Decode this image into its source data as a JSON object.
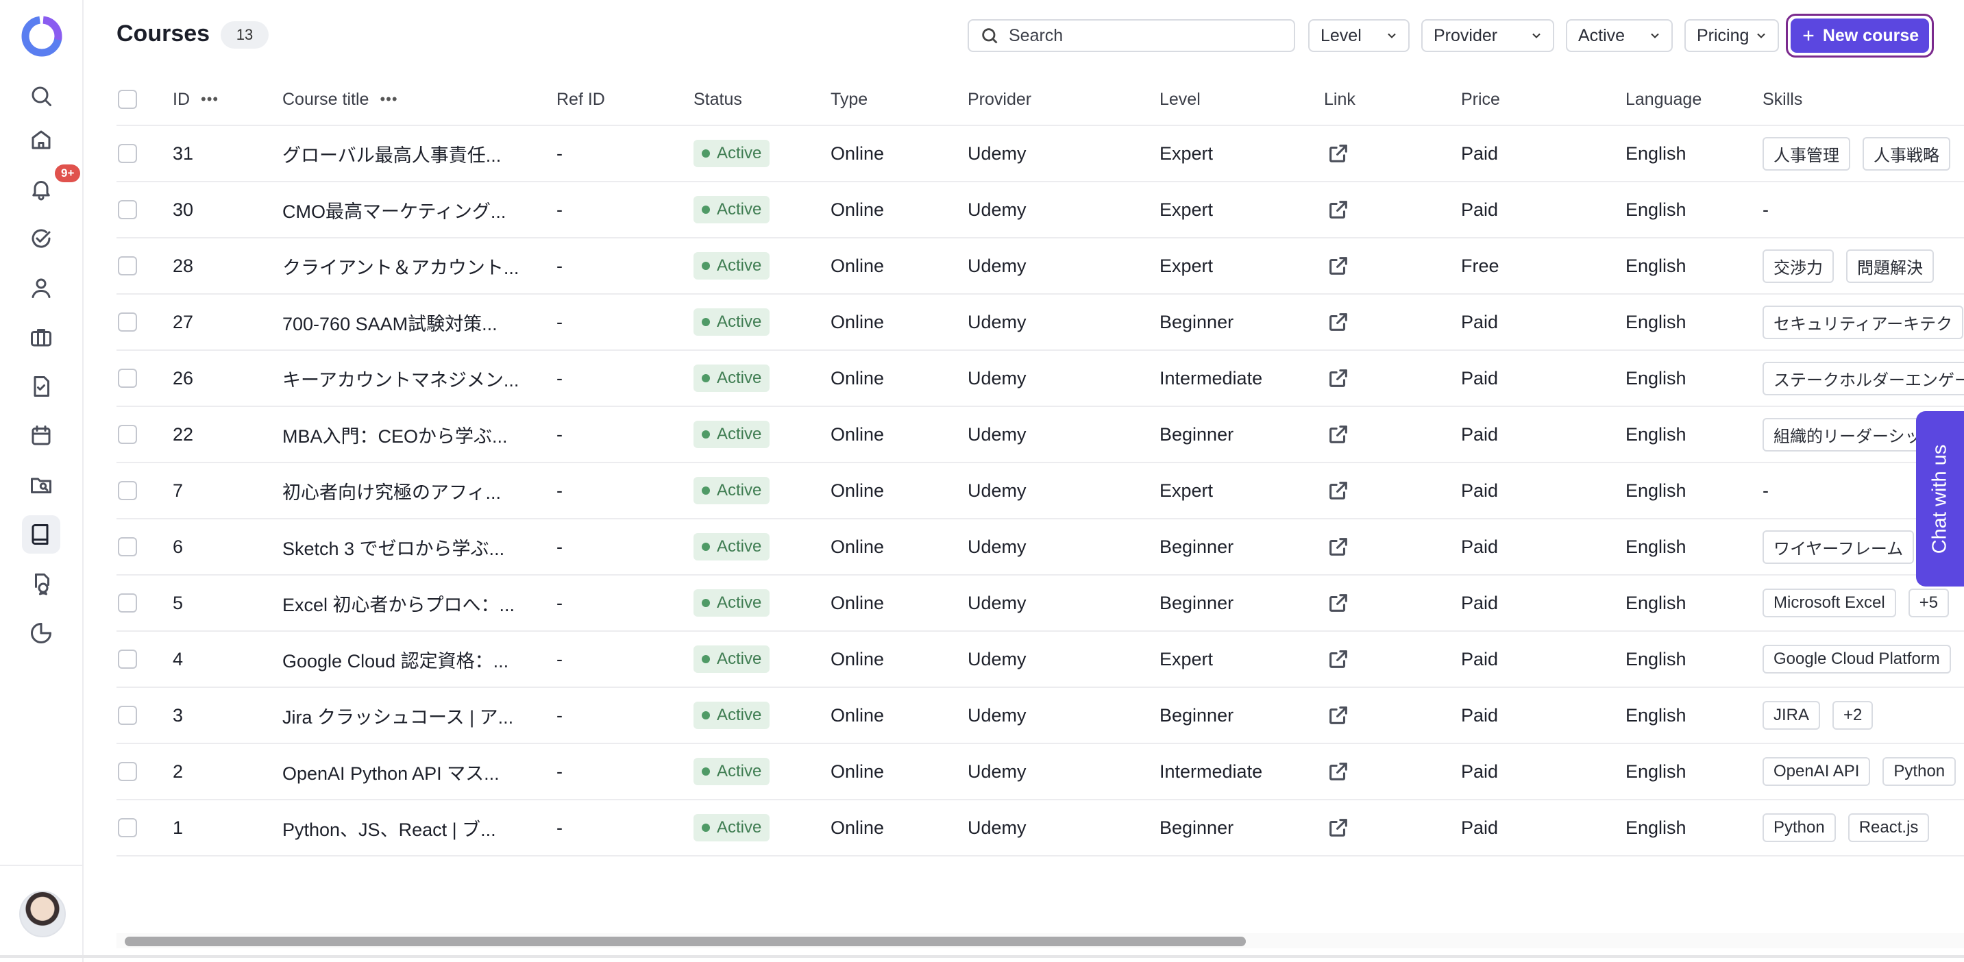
{
  "header": {
    "title": "Courses",
    "count": "13",
    "search_placeholder": "Search",
    "filters": [
      {
        "label": "Level"
      },
      {
        "label": "Provider"
      },
      {
        "label": "Active"
      },
      {
        "label": "Pricing"
      }
    ],
    "new_course_label": "New course"
  },
  "sidebar": {
    "notification_badge": "9+",
    "items": [
      "search-icon",
      "home-icon",
      "bell-icon",
      "check-circle-icon",
      "user-icon",
      "briefcase-icon",
      "document-check-icon",
      "calendar-icon",
      "folder-search-icon",
      "book-icon",
      "certificate-icon",
      "pie-chart-icon"
    ],
    "active_item": "book-icon"
  },
  "table": {
    "columns": [
      "ID",
      "Course title",
      "Ref ID",
      "Status",
      "Type",
      "Provider",
      "Level",
      "Link",
      "Price",
      "Language",
      "Skills"
    ],
    "rows": [
      {
        "id": "31",
        "title": "グローバル最高人事責任...",
        "ref": "-",
        "status": "Active",
        "type": "Online",
        "provider": "Udemy",
        "level": "Expert",
        "price": "Paid",
        "language": "English",
        "skills": [
          "人事管理",
          "人事戦略"
        ]
      },
      {
        "id": "30",
        "title": "CMO最高マーケティング...",
        "ref": "-",
        "status": "Active",
        "type": "Online",
        "provider": "Udemy",
        "level": "Expert",
        "price": "Paid",
        "language": "English",
        "skills_text": "-"
      },
      {
        "id": "28",
        "title": "クライアント＆アカウント...",
        "ref": "-",
        "status": "Active",
        "type": "Online",
        "provider": "Udemy",
        "level": "Expert",
        "price": "Free",
        "language": "English",
        "skills": [
          "交渉力",
          "問題解決"
        ]
      },
      {
        "id": "27",
        "title": "700-760 SAAM試験対策...",
        "ref": "-",
        "status": "Active",
        "type": "Online",
        "provider": "Udemy",
        "level": "Beginner",
        "price": "Paid",
        "language": "English",
        "skills": [
          "セキュリティアーキテク"
        ]
      },
      {
        "id": "26",
        "title": "キーアカウントマネジメン...",
        "ref": "-",
        "status": "Active",
        "type": "Online",
        "provider": "Udemy",
        "level": "Intermediate",
        "price": "Paid",
        "language": "English",
        "skills": [
          "ステークホルダーエンゲー"
        ]
      },
      {
        "id": "22",
        "title": "MBA入門：CEOから学ぶ...",
        "ref": "-",
        "status": "Active",
        "type": "Online",
        "provider": "Udemy",
        "level": "Beginner",
        "price": "Paid",
        "language": "English",
        "skills": [
          "組織的リーダーシッ"
        ]
      },
      {
        "id": "7",
        "title": "初心者向け究極のアフィ...",
        "ref": "-",
        "status": "Active",
        "type": "Online",
        "provider": "Udemy",
        "level": "Expert",
        "price": "Paid",
        "language": "English",
        "skills_text": "-"
      },
      {
        "id": "6",
        "title": "Sketch 3 でゼロから学ぶ...",
        "ref": "-",
        "status": "Active",
        "type": "Online",
        "provider": "Udemy",
        "level": "Beginner",
        "price": "Paid",
        "language": "English",
        "skills": [
          "ワイヤーフレーム"
        ]
      },
      {
        "id": "5",
        "title": "Excel 初心者からプロへ：...",
        "ref": "-",
        "status": "Active",
        "type": "Online",
        "provider": "Udemy",
        "level": "Beginner",
        "price": "Paid",
        "language": "English",
        "skills": [
          "Microsoft Excel",
          "+5"
        ]
      },
      {
        "id": "4",
        "title": "Google Cloud 認定資格：...",
        "ref": "-",
        "status": "Active",
        "type": "Online",
        "provider": "Udemy",
        "level": "Expert",
        "price": "Paid",
        "language": "English",
        "skills": [
          "Google Cloud Platform"
        ]
      },
      {
        "id": "3",
        "title": "Jira クラッシュコース | ア...",
        "ref": "-",
        "status": "Active",
        "type": "Online",
        "provider": "Udemy",
        "level": "Beginner",
        "price": "Paid",
        "language": "English",
        "skills": [
          "JIRA",
          "+2"
        ]
      },
      {
        "id": "2",
        "title": "OpenAI Python API マス...",
        "ref": "-",
        "status": "Active",
        "type": "Online",
        "provider": "Udemy",
        "level": "Intermediate",
        "price": "Paid",
        "language": "English",
        "skills": [
          "OpenAI API",
          "Python"
        ]
      },
      {
        "id": "1",
        "title": "Python、JS、React | ブ...",
        "ref": "-",
        "status": "Active",
        "type": "Online",
        "provider": "Udemy",
        "level": "Beginner",
        "price": "Paid",
        "language": "English",
        "skills": [
          "Python",
          "React.js"
        ]
      }
    ]
  },
  "chat": {
    "label": "Chat with us"
  },
  "colors": {
    "accent": "#5b47e0",
    "status_bg": "#e4f1e7",
    "status_fg": "#3f7d52",
    "badge": "#e0524d"
  }
}
